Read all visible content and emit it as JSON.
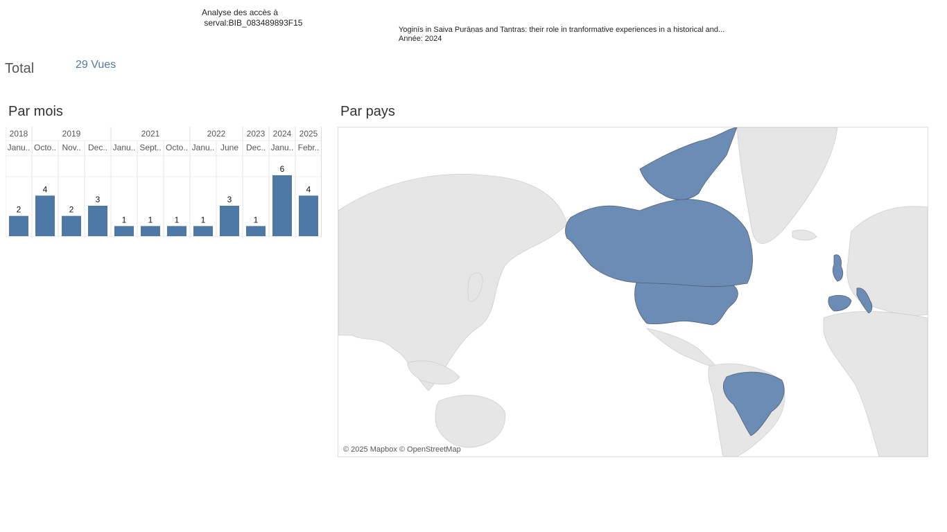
{
  "header": {
    "title": "Analyse des accès à\n serval:BIB_083489893F15"
  },
  "document": {
    "title": "Yoginīs in Saiva Purāṇas and Tantras: their role in tranformative experiences in a historical and...",
    "year_text": "Année: 2024"
  },
  "total": {
    "label": "Total",
    "value": "29 Vues"
  },
  "sections": {
    "by_month": "Par mois",
    "by_country": "Par pays"
  },
  "map": {
    "attribution": "© 2025 Mapbox © OpenStreetMap",
    "highlighted_countries": [
      "Canada",
      "United States",
      "Brazil",
      "United Kingdom",
      "Spain",
      "Italy"
    ],
    "highlight_color": "#4e79a7",
    "land_color": "#e6e6e6",
    "ocean_color": "#ffffff"
  },
  "chart_data": {
    "type": "bar",
    "title": "Par mois",
    "color": "#4e79a7",
    "years": [
      {
        "label": "2018",
        "span": 1
      },
      {
        "label": "2019",
        "span": 3
      },
      {
        "label": "2021",
        "span": 3
      },
      {
        "label": "2022",
        "span": 2
      },
      {
        "label": "2023",
        "span": 1
      },
      {
        "label": "2024",
        "span": 1
      },
      {
        "label": "2025",
        "span": 1
      }
    ],
    "categories": [
      "Janu..",
      "Octo..",
      "Nov..",
      "Dec..",
      "Janu..",
      "Sept..",
      "Octo..",
      "Janu..",
      "June",
      "Dec..",
      "Janu..",
      "Febr.."
    ],
    "values": [
      2,
      4,
      2,
      3,
      1,
      1,
      1,
      1,
      3,
      1,
      6,
      4
    ],
    "ylim": [
      0,
      6
    ],
    "grid": true
  }
}
